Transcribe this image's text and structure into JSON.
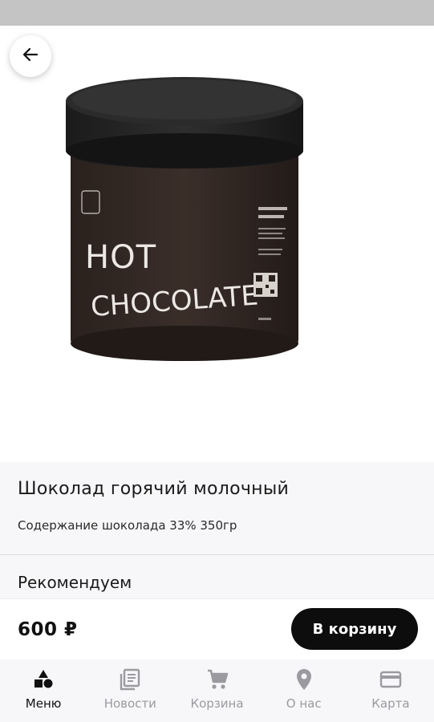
{
  "product": {
    "title": "Шоколад горячий молочный",
    "description": "Содержание шоколада 33% 350гр",
    "price": "600 ₽",
    "image_label_line1": "HOT",
    "image_label_line2": "CHOCOLATE"
  },
  "recommend": {
    "title": "Рекомендуем"
  },
  "actions": {
    "add_to_cart_label": "В корзину"
  },
  "nav": {
    "items": [
      {
        "label": "Меню",
        "icon": "shapes-icon",
        "active": true
      },
      {
        "label": "Новости",
        "icon": "news-icon",
        "active": false
      },
      {
        "label": "Корзина",
        "icon": "cart-icon",
        "active": false
      },
      {
        "label": "О нас",
        "icon": "location-pin-icon",
        "active": false
      },
      {
        "label": "Карта",
        "icon": "credit-card-icon",
        "active": false
      }
    ]
  },
  "colors": {
    "status_bar": "#c4c4c4",
    "primary_button": "#0d0d0d",
    "nav_inactive": "#9a9aa0",
    "section_bg": "#f7f7f9"
  }
}
